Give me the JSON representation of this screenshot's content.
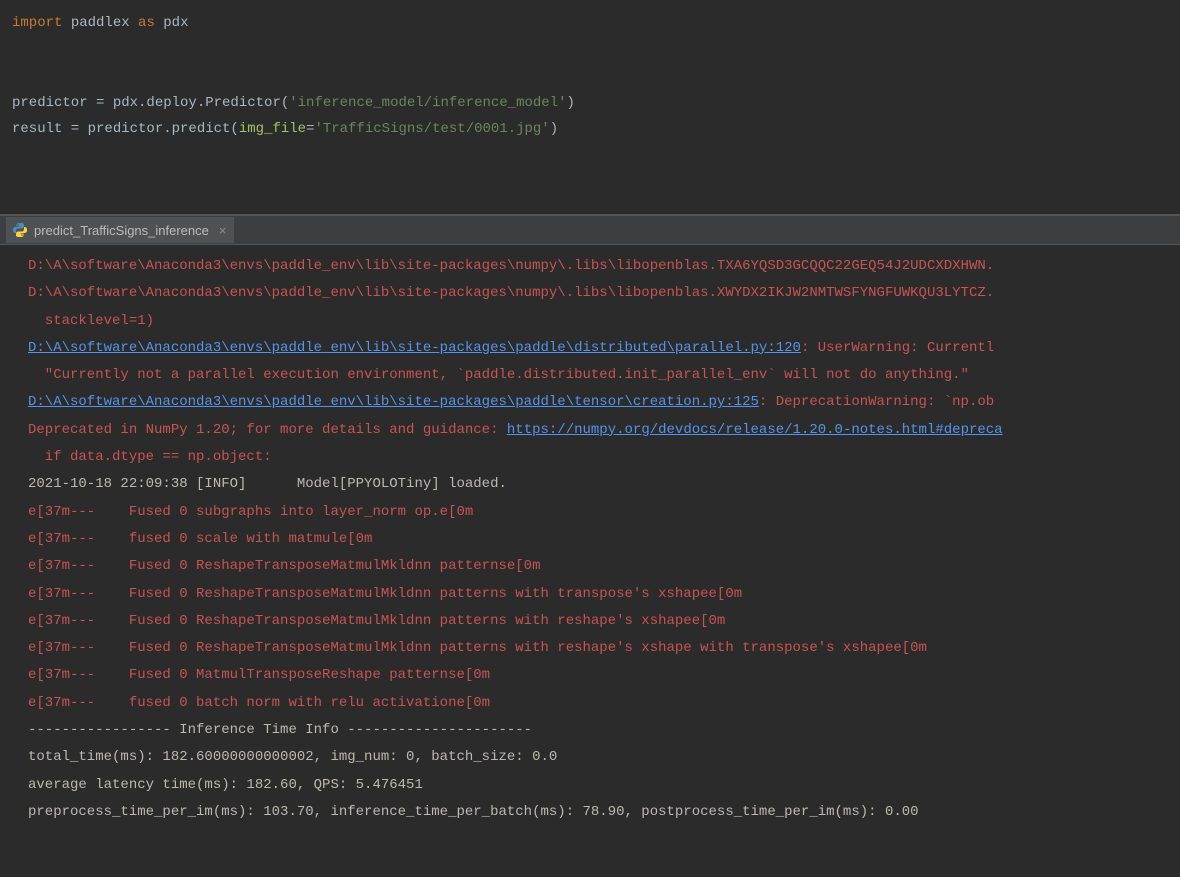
{
  "editor": {
    "line1": {
      "kw1": "import",
      "mod": " paddlex ",
      "kw2": "as",
      "alias": " pdx"
    },
    "line3a": "predictor = pdx.deploy.Predictor(",
    "line3str": "'inference_model/inference_model'",
    "line3b": ")",
    "line4a": "result = predictor.predict(",
    "line4param": "img_file",
    "line4eq": "=",
    "line4str": "'TrafficSigns/test/0001.jpg'",
    "line4b": ")"
  },
  "tab": {
    "label": "predict_TrafficSigns_inference"
  },
  "console": {
    "l1": "D:\\A\\software\\Anaconda3\\envs\\paddle_env\\lib\\site-packages\\numpy\\.libs\\libopenblas.TXA6YQSD3GCQQC22GEQ54J2UDCXDXHWN.",
    "l2": "D:\\A\\software\\Anaconda3\\envs\\paddle_env\\lib\\site-packages\\numpy\\.libs\\libopenblas.XWYDX2IKJW2NMTWSFYNGFUWKQU3LYTCZ.",
    "l3": "  stacklevel=1)",
    "l4link": "D:\\A\\software\\Anaconda3\\envs\\paddle_env\\lib\\site-packages\\paddle\\distributed\\parallel.py:120",
    "l4rest": ": UserWarning: Currentl",
    "l5": "  \"Currently not a parallel execution environment, `paddle.distributed.init_parallel_env` will not do anything.\"",
    "l6link": "D:\\A\\software\\Anaconda3\\envs\\paddle_env\\lib\\site-packages\\paddle\\tensor\\creation.py:125",
    "l6rest": ": DeprecationWarning: `np.ob",
    "l7a": "Deprecated in NumPy 1.20; for more details and guidance: ",
    "l7link": "https://numpy.org/devdocs/release/1.20.0-notes.html#depreca",
    "l8": "  if data.dtype == np.object:",
    "l9": "2021-10-18 22:09:38 [INFO]\tModel[PPYOLOTiny] loaded.",
    "l10": "e[37m---    Fused 0 subgraphs into layer_norm op.e[0m",
    "l11": "e[37m---    fused 0 scale with matmule[0m",
    "l12": "e[37m---    Fused 0 ReshapeTransposeMatmulMkldnn patternse[0m",
    "l13": "e[37m---    Fused 0 ReshapeTransposeMatmulMkldnn patterns with transpose's xshapee[0m",
    "l14": "e[37m---    Fused 0 ReshapeTransposeMatmulMkldnn patterns with reshape's xshapee[0m",
    "l15": "e[37m---    Fused 0 ReshapeTransposeMatmulMkldnn patterns with reshape's xshape with transpose's xshapee[0m",
    "l16": "e[37m---    Fused 0 MatmulTransposeReshape patternse[0m",
    "l17": "e[37m---    fused 0 batch norm with relu activatione[0m",
    "l18": "----------------- Inference Time Info ----------------------",
    "l19": "total_time(ms): 182.60000000000002, img_num: 0, batch_size: 0.0",
    "l20": "average latency time(ms): 182.60, QPS: 5.476451",
    "l21": "preprocess_time_per_im(ms): 103.70, inference_time_per_batch(ms): 78.90, postprocess_time_per_im(ms): 0.00"
  }
}
